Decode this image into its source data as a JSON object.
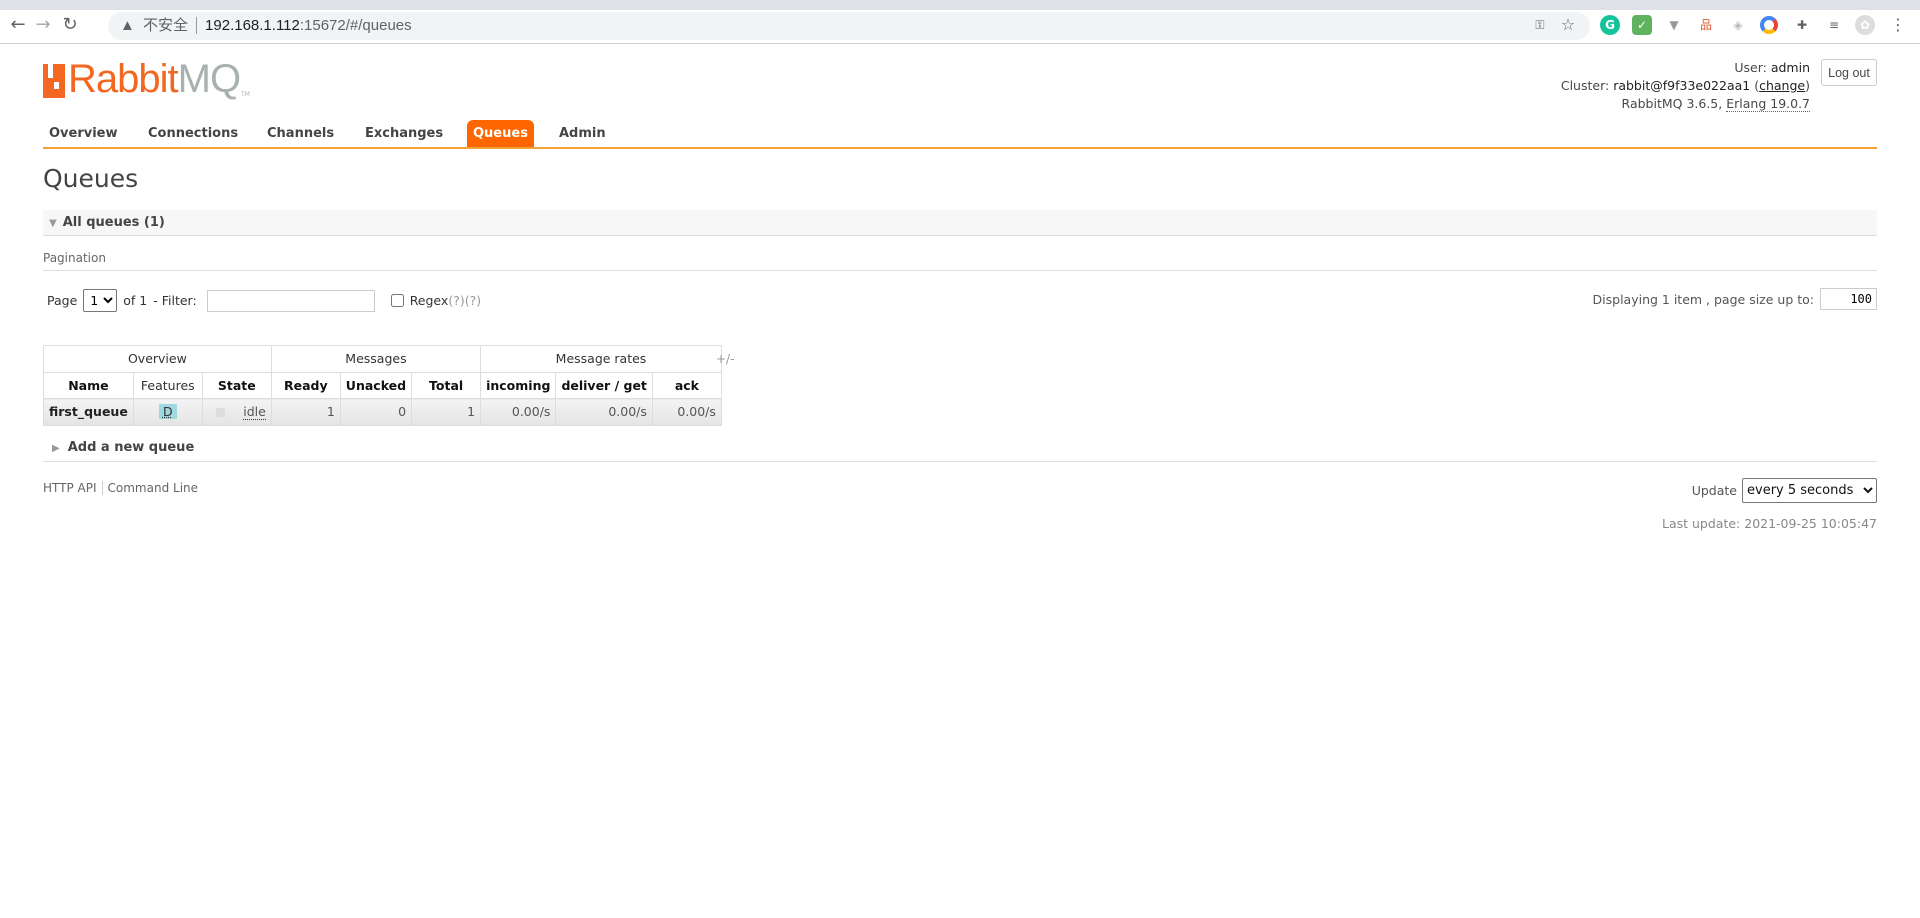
{
  "browser": {
    "security_label": "不安全",
    "url_host": "192.168.1.112",
    "url_rest": ":15672/#/queues"
  },
  "logo": {
    "text_rabbit": "Rabbit",
    "text_mq": "MQ",
    "tm": "TM"
  },
  "user": {
    "user_label": "User:",
    "user": "admin",
    "cluster_label": "Cluster:",
    "cluster": "rabbit@f9f33e022aa1",
    "change": "change",
    "version": "RabbitMQ 3.6.5,",
    "erlang": "Erlang 19.0.7",
    "logout": "Log out"
  },
  "nav": {
    "items": [
      "Overview",
      "Connections",
      "Channels",
      "Exchanges",
      "Queues",
      "Admin"
    ],
    "active": "Queues"
  },
  "page_title": "Queues",
  "section": {
    "title": "All queues (1)"
  },
  "pagination": {
    "label": "Pagination",
    "page_label": "Page",
    "page_value": "1",
    "of_label": "of 1",
    "filter_label": "- Filter:",
    "filter_value": "",
    "regex_label": "Regex",
    "help1": "(?)",
    "help2": "(?)",
    "displaying": "Displaying 1 item , page size up to:",
    "page_size": "100"
  },
  "table": {
    "groups": [
      "Overview",
      "Messages",
      "Message rates"
    ],
    "columns": [
      "Name",
      "Features",
      "State",
      "Ready",
      "Unacked",
      "Total",
      "incoming",
      "deliver / get",
      "ack"
    ],
    "toggle": "+/-",
    "rows": [
      {
        "name": "first_queue",
        "features": "D",
        "state": "idle",
        "ready": "1",
        "unacked": "0",
        "total": "1",
        "incoming": "0.00/s",
        "deliver_get": "0.00/s",
        "ack": "0.00/s"
      }
    ]
  },
  "add_queue": "Add a new queue",
  "footer": {
    "http_api": "HTTP API",
    "command_line": "Command Line",
    "update_label": "Update",
    "update_value": "every 5 seconds",
    "last_update": "Last update: 2021-09-25 10:05:47"
  },
  "colors": {
    "accent": "#ff6600",
    "logo": "#f26822",
    "nav_line": "#f5a23a"
  }
}
